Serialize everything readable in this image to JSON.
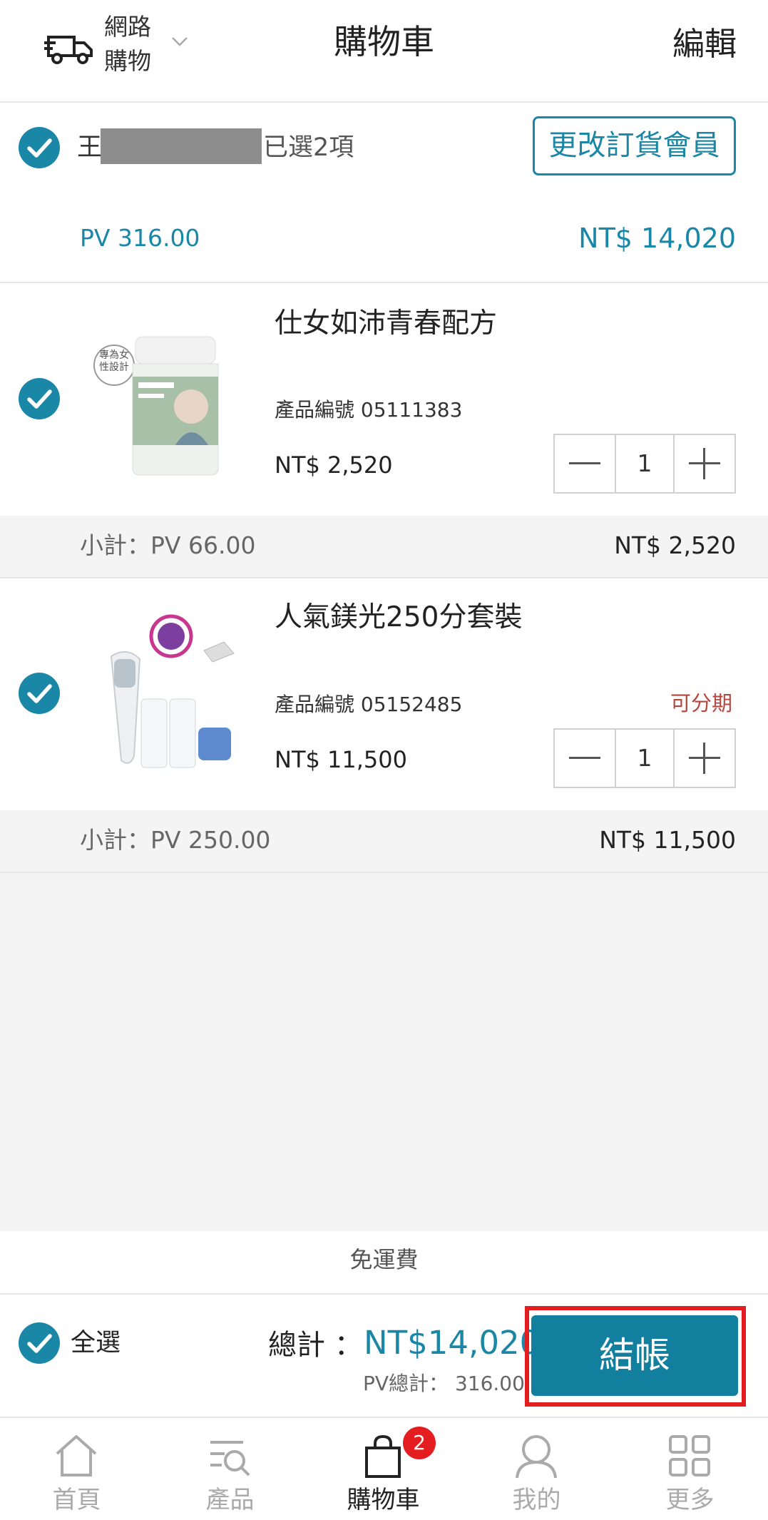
{
  "header": {
    "shipping_label_line1": "網路",
    "shipping_label_line2": "購物",
    "title": "購物車",
    "edit_label": "編輯"
  },
  "member": {
    "name_visible": "王",
    "selected_count": "已選2項",
    "change_button": "更改訂貨會員",
    "pv_total": "PV 316.00",
    "nt_total": "NT$ 14,020"
  },
  "products": [
    {
      "name": "仕女如沛青春配方",
      "code": "產品編號 05111383",
      "price": "NT$ 2,520",
      "quantity": "1",
      "subtotal_pv": "小計：PV 66.00",
      "subtotal_nt": "NT$ 2,520",
      "image_badge": "專為女性設計"
    },
    {
      "name": "人氣鎂光250分套裝",
      "code": "產品編號 05152485",
      "installment": "可分期",
      "price": "NT$ 11,500",
      "quantity": "1",
      "subtotal_pv": "小計：PV 250.00",
      "subtotal_nt": "NT$ 11,500"
    }
  ],
  "footer": {
    "free_shipping": "免運費",
    "select_all": "全選",
    "total_label": "總計 ：",
    "total_value": "NT$14,020",
    "pv_sum": "PV總計： 316.00",
    "checkout_button": "結帳"
  },
  "nav": {
    "items": [
      {
        "label": "首頁",
        "icon": "home-icon"
      },
      {
        "label": "產品",
        "icon": "product-search-icon"
      },
      {
        "label": "購物車",
        "icon": "shopping-bag-icon"
      },
      {
        "label": "我的",
        "icon": "user-icon"
      },
      {
        "label": "更多",
        "icon": "grid-icon"
      }
    ],
    "cart_badge": "2"
  },
  "colors": {
    "accent": "#1b87a7",
    "checkout": "#127f9e",
    "installment": "#b4473f",
    "highlight_box": "#e41d20"
  }
}
